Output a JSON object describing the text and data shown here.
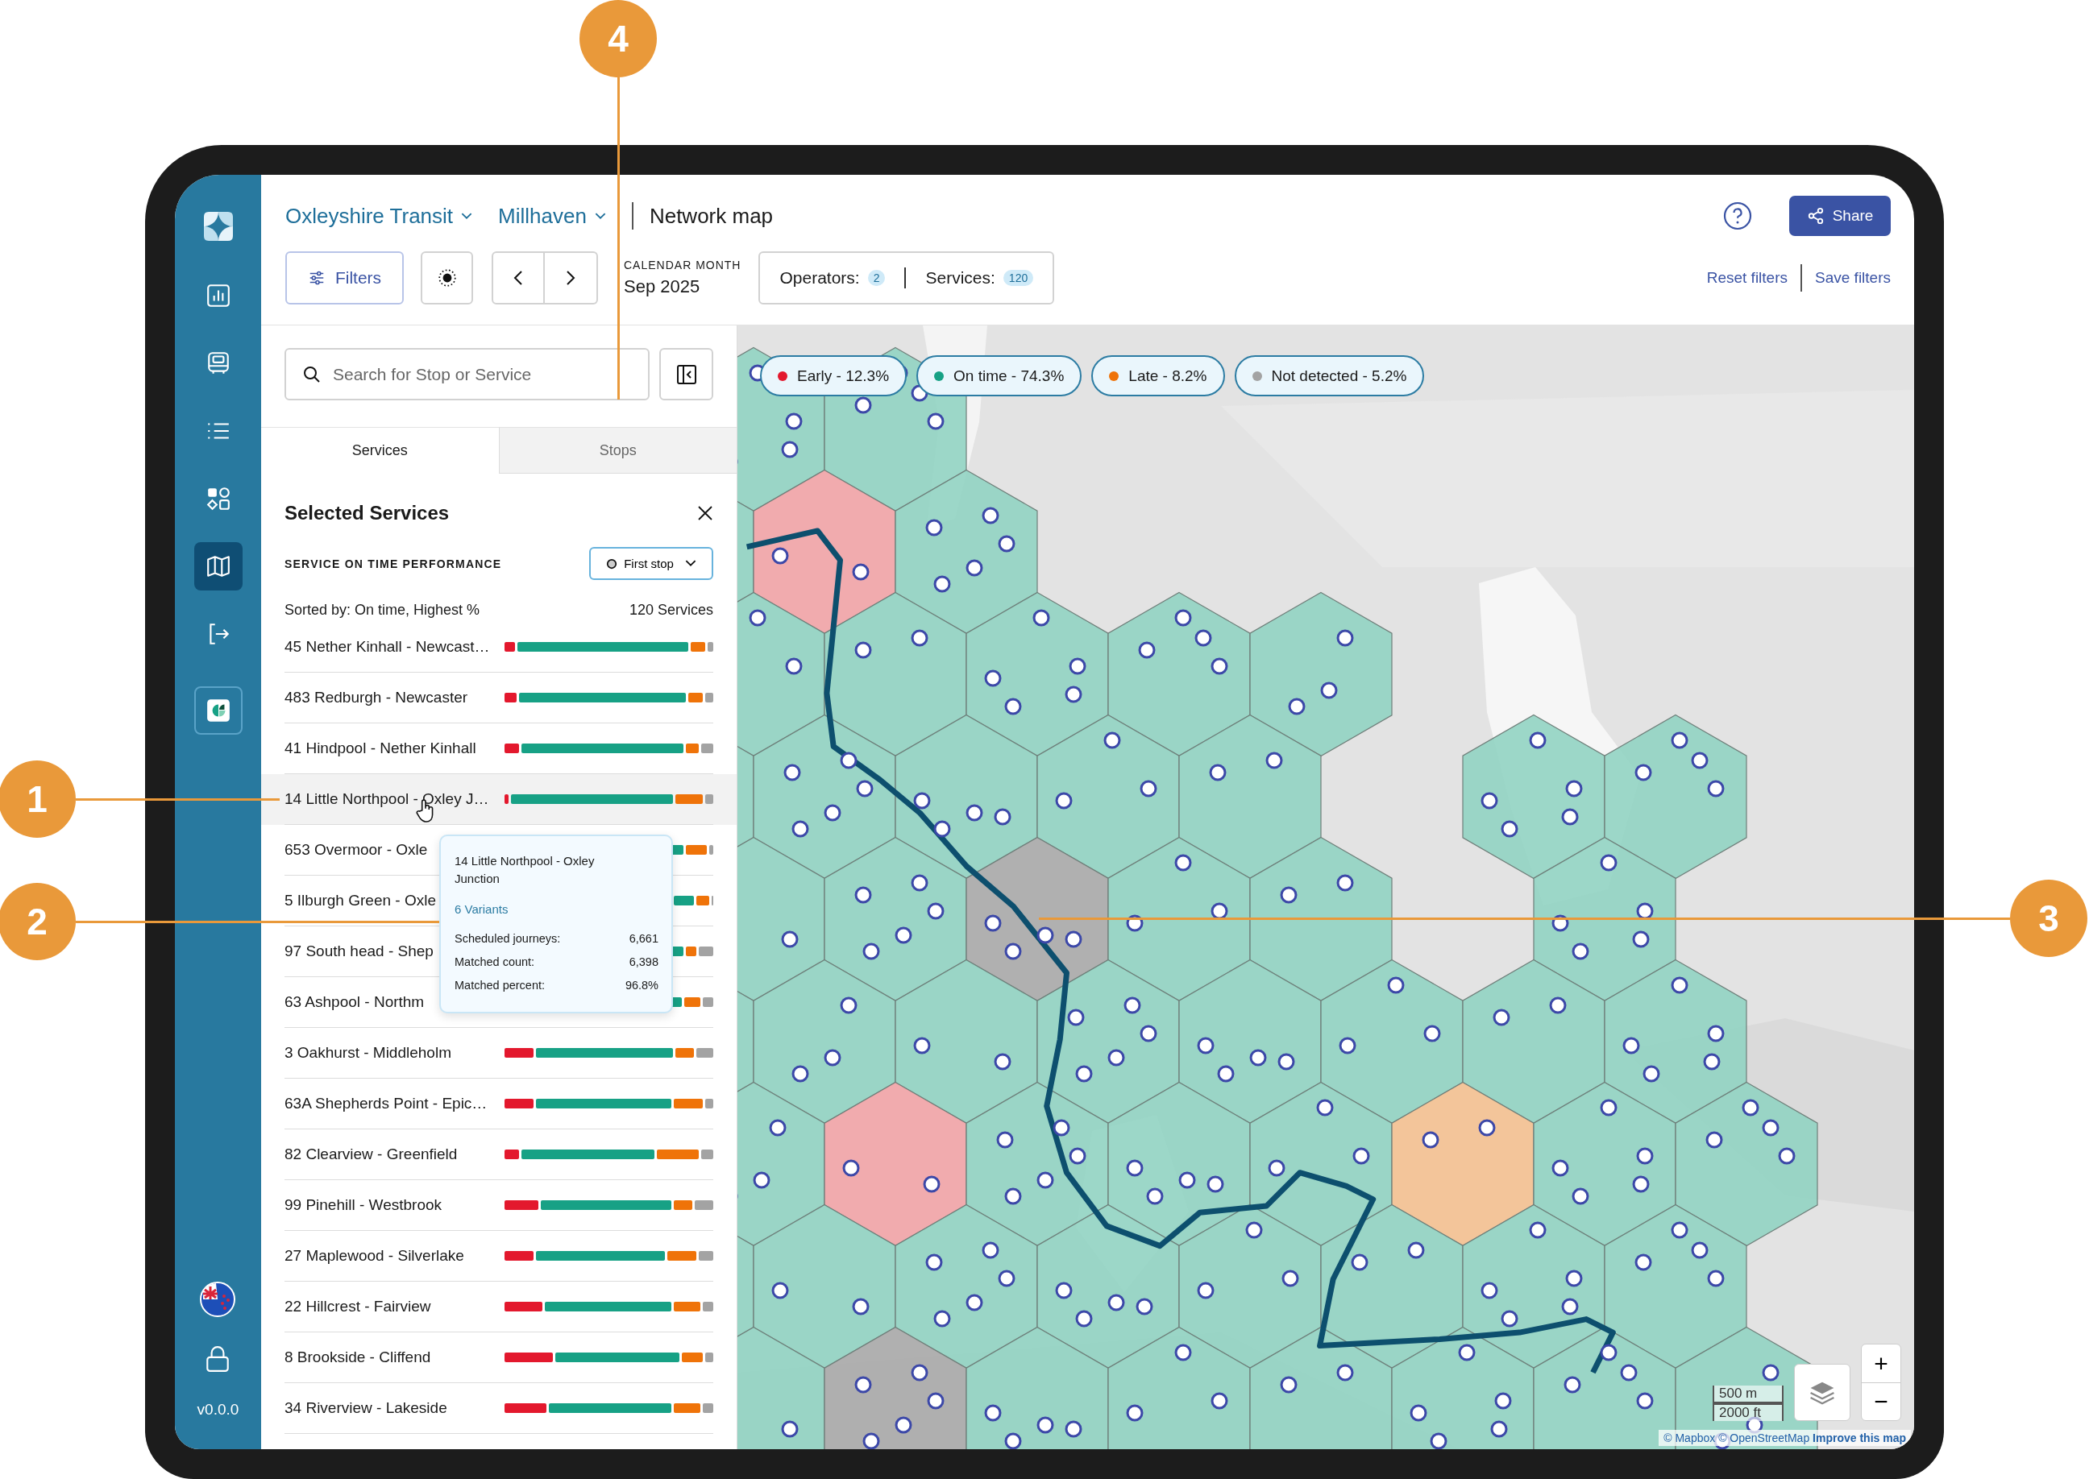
{
  "sidebar": {
    "nav": [
      {
        "kind": "chart",
        "selected": false
      },
      {
        "kind": "bus",
        "selected": false
      },
      {
        "kind": "list",
        "selected": false
      },
      {
        "kind": "apps",
        "selected": false
      },
      {
        "kind": "map",
        "selected": true
      },
      {
        "kind": "exit",
        "selected": false
      },
      {
        "kind": "app",
        "selected": false
      }
    ],
    "version": "v0.0.0"
  },
  "header": {
    "breadcrumbs": [
      {
        "label": "Oxleyshire Transit",
        "dropdown": true
      },
      {
        "label": "Millhaven",
        "dropdown": true
      }
    ],
    "page_title": "Network map",
    "share_label": "Share",
    "filters_label": "Filters",
    "period": {
      "caption": "CALENDAR MONTH",
      "value": "Sep 2025"
    },
    "counts": [
      {
        "label": "Operators:",
        "value": "2"
      },
      {
        "label": "Services:",
        "value": "120"
      }
    ],
    "links": [
      "Reset filters",
      "Save filters"
    ]
  },
  "panel": {
    "search": {
      "placeholder": "Search for Stop or Service"
    },
    "tabs": [
      {
        "label": "Services",
        "selected": true
      },
      {
        "label": "Stops",
        "selected": false
      }
    ],
    "heading": "Selected Services",
    "section_title": "SERVICE ON TIME PERFORMANCE",
    "mode": "First stop",
    "sorted_by": "Sorted by: On time, Highest %",
    "total": "120 Services",
    "rows": [
      {
        "name": "45 Nether Kinhall - Newcast…",
        "hovered": false,
        "bar": [
          {
            "kind": "early"
          },
          {
            "kind": "on_time"
          },
          {
            "kind": "late"
          },
          {
            "kind": "not_detected"
          }
        ]
      },
      {
        "name": "483 Redburgh - Newcaster",
        "hovered": false,
        "bar": [
          {
            "kind": "early"
          },
          {
            "kind": "on_time"
          },
          {
            "kind": "late"
          },
          {
            "kind": "not_detected"
          }
        ]
      },
      {
        "name": "41 Hindpool - Nether Kinhall",
        "hovered": false,
        "bar": [
          {
            "kind": "early"
          },
          {
            "kind": "on_time"
          },
          {
            "kind": "late"
          },
          {
            "kind": "not_detected"
          }
        ]
      },
      {
        "name": "14 Little Northpool - Oxley J…",
        "hovered": true,
        "bar": [
          {
            "kind": "early"
          },
          {
            "kind": "on_time"
          },
          {
            "kind": "late"
          },
          {
            "kind": "not_detected"
          }
        ]
      },
      {
        "name": "653 Overmoor - Oxle",
        "hovered": false,
        "bar": [
          {
            "kind": "on_time"
          },
          {
            "kind": "late"
          },
          {
            "kind": "not_detected"
          }
        ]
      },
      {
        "name": "5 Ilburgh Green - Oxle",
        "hovered": false,
        "bar": [
          {
            "kind": "on_time"
          },
          {
            "kind": "late"
          },
          {
            "kind": "not_detected"
          }
        ]
      },
      {
        "name": "97 South head - Shep",
        "hovered": false,
        "bar": [
          {
            "kind": "on_time"
          },
          {
            "kind": "late"
          },
          {
            "kind": "not_detected"
          }
        ]
      },
      {
        "name": "63 Ashpool - Northm",
        "hovered": false,
        "bar": [
          {
            "kind": "on_time"
          },
          {
            "kind": "late"
          },
          {
            "kind": "not_detected"
          }
        ]
      },
      {
        "name": "3 Oakhurst - Middleholm",
        "hovered": false,
        "bar": [
          {
            "kind": "early"
          },
          {
            "kind": "on_time"
          },
          {
            "kind": "late"
          },
          {
            "kind": "not_detected"
          }
        ]
      },
      {
        "name": "63A Shepherds Point - Epic…",
        "hovered": false,
        "bar": [
          {
            "kind": "early"
          },
          {
            "kind": "on_time"
          },
          {
            "kind": "late"
          },
          {
            "kind": "not_detected"
          }
        ]
      },
      {
        "name": "82 Clearview - Greenfield",
        "hovered": false,
        "bar": [
          {
            "kind": "early"
          },
          {
            "kind": "on_time"
          },
          {
            "kind": "late"
          },
          {
            "kind": "not_detected"
          }
        ]
      },
      {
        "name": "99 Pinehill - Westbrook",
        "hovered": false,
        "bar": [
          {
            "kind": "early"
          },
          {
            "kind": "on_time"
          },
          {
            "kind": "late"
          },
          {
            "kind": "not_detected"
          }
        ]
      },
      {
        "name": "27 Maplewood - Silverlake",
        "hovered": false,
        "bar": [
          {
            "kind": "early"
          },
          {
            "kind": "on_time"
          },
          {
            "kind": "late"
          },
          {
            "kind": "not_detected"
          }
        ]
      },
      {
        "name": "22 Hillcrest - Fairview",
        "hovered": false,
        "bar": [
          {
            "kind": "early"
          },
          {
            "kind": "on_time"
          },
          {
            "kind": "late"
          },
          {
            "kind": "not_detected"
          }
        ]
      },
      {
        "name": "8 Brookside - Cliffend",
        "hovered": false,
        "bar": [
          {
            "kind": "early"
          },
          {
            "kind": "on_time"
          },
          {
            "kind": "late"
          },
          {
            "kind": "not_detected"
          }
        ]
      },
      {
        "name": "34 Riverview - Lakeside",
        "hovered": false,
        "bar": [
          {
            "kind": "early"
          },
          {
            "kind": "on_time"
          },
          {
            "kind": "late"
          },
          {
            "kind": "not_detected"
          }
        ]
      }
    ]
  },
  "tooltip": {
    "title": "14 Little Northpool - Oxley Junction",
    "variants": "6 Variants",
    "stats": [
      {
        "label": "Scheduled journeys:",
        "value": "6,661"
      },
      {
        "label": "Matched count:",
        "value": "6,398"
      },
      {
        "label": "Matched percent:",
        "value": "96.8%"
      }
    ]
  },
  "map": {
    "legend": [
      {
        "label": "Early - 12.3%",
        "color": "#e3182d"
      },
      {
        "label": "On time - 74.3%",
        "color": "#17a185"
      },
      {
        "label": "Late - 8.2%",
        "color": "#ef7309"
      },
      {
        "label": "Not detected - 5.2%",
        "color": "#a3a3a3"
      }
    ],
    "scale": [
      "500 m",
      "2000 ft"
    ],
    "zoom": [
      "+",
      "−"
    ],
    "attribution": "© Mapbox © OpenStreetMap **Improve this map**"
  },
  "callouts": [
    {
      "label": "4"
    },
    {
      "label": "1"
    },
    {
      "label": "2"
    },
    {
      "label": "3"
    }
  ]
}
